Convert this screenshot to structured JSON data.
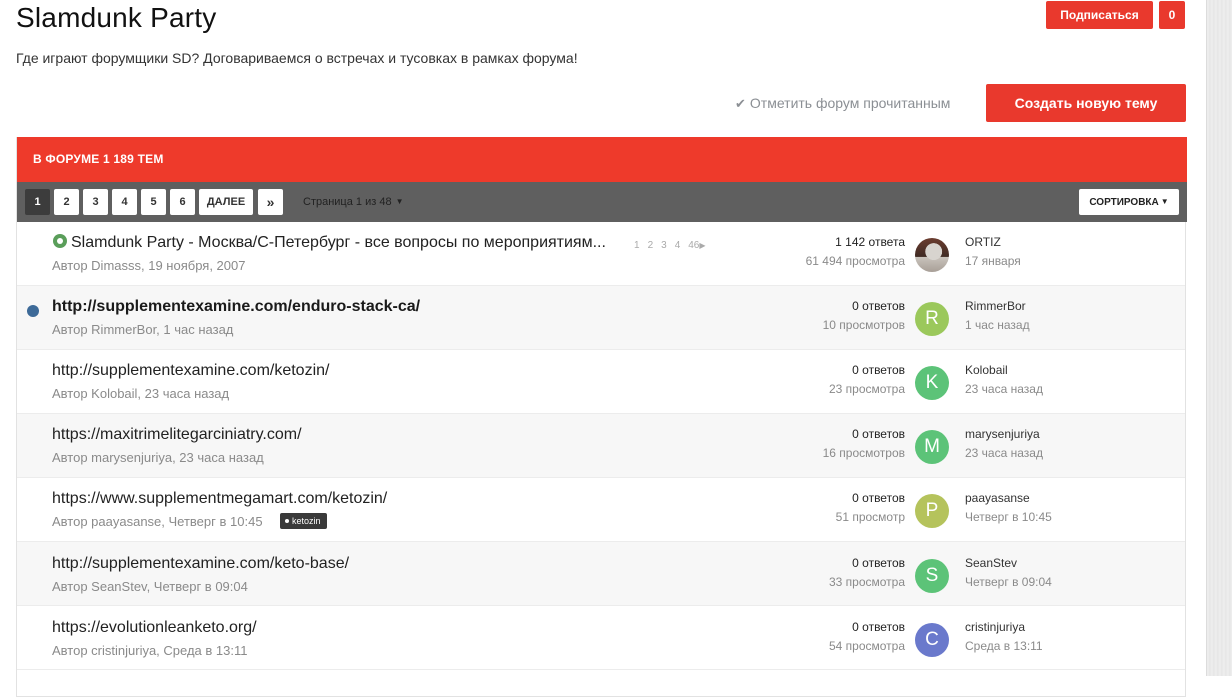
{
  "forum": {
    "title": "Slamdunk Party",
    "description": "Где играют форумщики SD? Договариваемся о встречах и тусовках в рамках форума!",
    "subscribe_label": "Подписаться",
    "subscribe_count": "0",
    "mark_read_label": "Отметить форум прочитанным",
    "create_topic_label": "Создать новую тему",
    "topics_header": "В ФОРУМЕ 1 189 ТЕМ"
  },
  "pagination": {
    "pages": [
      "1",
      "2",
      "3",
      "4",
      "5",
      "6"
    ],
    "active": "1",
    "next_label": "ДАЛЕЕ",
    "last_label": "»",
    "page_info": "Страница 1 из 48",
    "sort_label": "СОРТИРОВКА"
  },
  "colors": {
    "accent": "#e9392d",
    "header_red": "#ee3a2b",
    "pager_bar": "#5f5f5f",
    "unread_dot": "#3d6a98"
  },
  "topics": [
    {
      "title": "Slamdunk Party - Москва/С-Петербург - все вопросы по мероприятиям...",
      "meta": "Автор Dimasss, 19 ноября, 2007",
      "pinned": true,
      "mini_pages": [
        "1",
        "2",
        "3",
        "4",
        "46"
      ],
      "replies": "1 142 ответа",
      "views": "61 494 просмотра",
      "avatar_letter": "",
      "avatar_color": "",
      "last_user": "ORTIZ",
      "last_time": "17 января"
    },
    {
      "title": "http://supplementexamine.com/enduro-stack-ca/",
      "meta": "Автор RimmerBor, 1 час назад",
      "unread": true,
      "replies": "0 ответов",
      "views": "10 просмотров",
      "avatar_letter": "R",
      "avatar_color": "#9bc85b",
      "last_user": "RimmerBor",
      "last_time": "1 час назад"
    },
    {
      "title": "http://supplementexamine.com/ketozin/",
      "meta": "Автор Kolobail, 23 часа назад",
      "replies": "0 ответов",
      "views": "23 просмотра",
      "avatar_letter": "K",
      "avatar_color": "#5cc378",
      "last_user": "Kolobail",
      "last_time": "23 часа назад"
    },
    {
      "title": "https://maxitrimelitegarciniatry.com/",
      "meta": "Автор marysenjuriya, 23 часа назад",
      "replies": "0 ответов",
      "views": "16 просмотров",
      "avatar_letter": "M",
      "avatar_color": "#5cc378",
      "last_user": "marysenjuriya",
      "last_time": "23 часа назад"
    },
    {
      "title": "https://www.supplementmegamart.com/ketozin/",
      "meta": "Автор paayasanse, Четверг в 10:45",
      "tag": "ketozin",
      "replies": "0 ответов",
      "views": "51 просмотр",
      "avatar_letter": "P",
      "avatar_color": "#b5c35c",
      "last_user": "paayasanse",
      "last_time": "Четверг в 10:45"
    },
    {
      "title": "http://supplementexamine.com/keto-base/",
      "meta": "Автор SeanStev, Четверг в 09:04",
      "replies": "0 ответов",
      "views": "33 просмотра",
      "avatar_letter": "S",
      "avatar_color": "#5cc378",
      "last_user": "SeanStev",
      "last_time": "Четверг в 09:04"
    },
    {
      "title": "https://evolutionleanketo.org/",
      "meta": "Автор cristinjuriya, Среда в 13:11",
      "replies": "0 ответов",
      "views": "54 просмотра",
      "avatar_letter": "C",
      "avatar_color": "#6a79cc",
      "last_user": "cristinjuriya",
      "last_time": "Среда в 13:11"
    }
  ]
}
